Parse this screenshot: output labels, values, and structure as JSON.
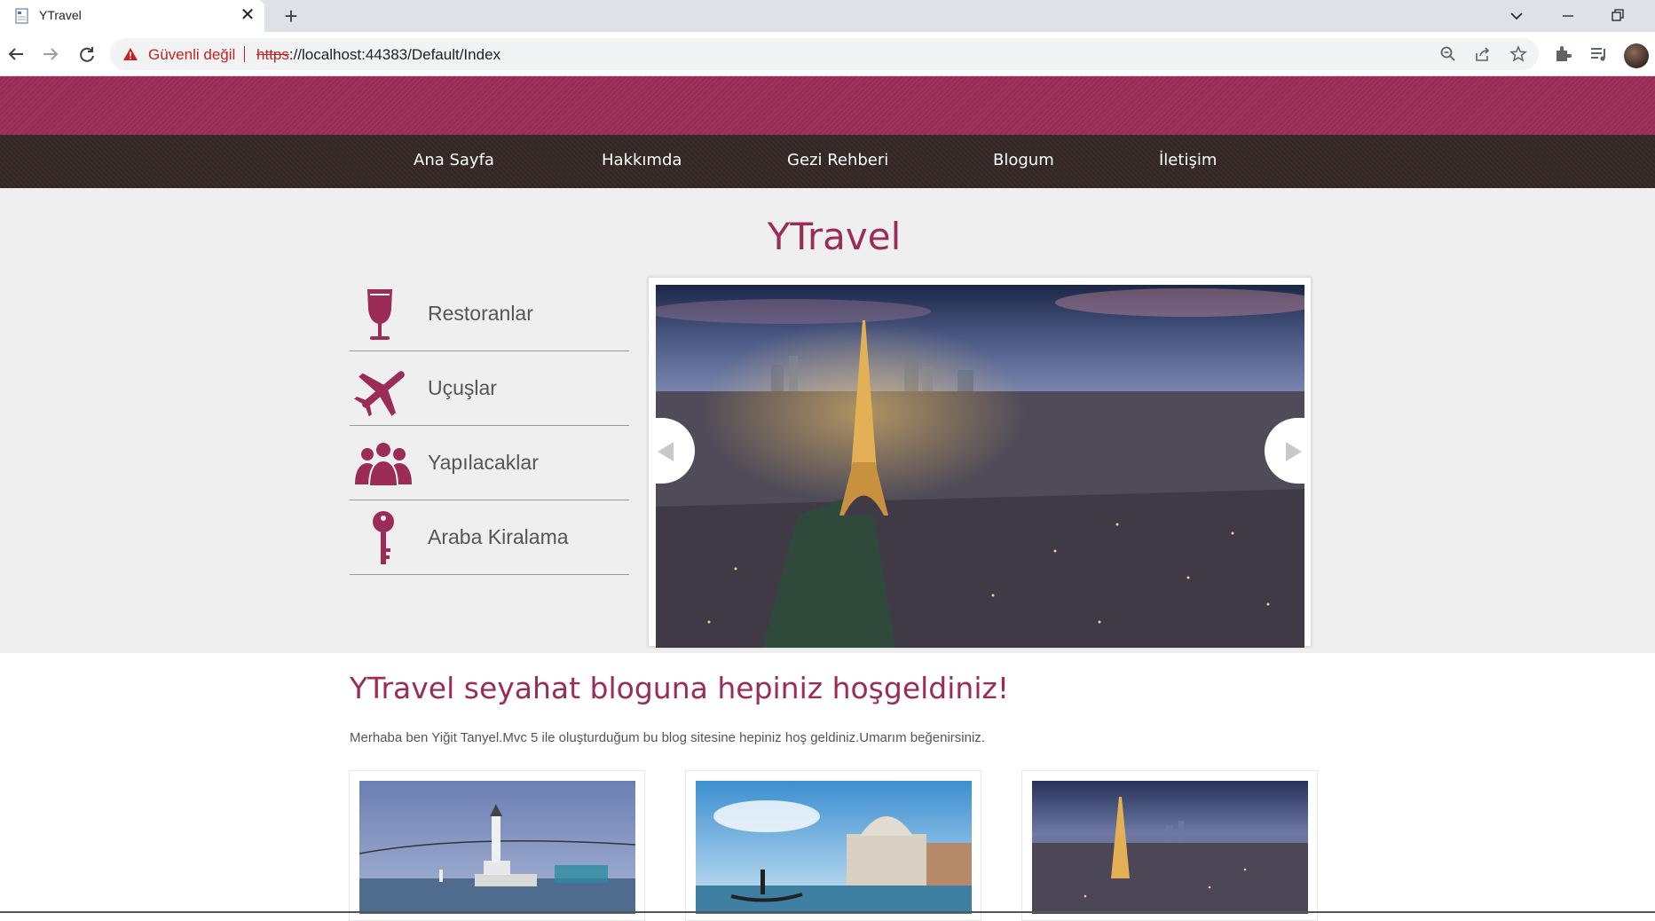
{
  "browser": {
    "tab_title": "YTravel",
    "security_label": "Güvenli değil",
    "url_scheme": "https",
    "url_rest": "://localhost:44383/Default/Index"
  },
  "nav": {
    "items": [
      {
        "label": "Ana Sayfa"
      },
      {
        "label": "Hakkımda"
      },
      {
        "label": "Gezi Rehberi"
      },
      {
        "label": "Blogum"
      },
      {
        "label": "İletişim"
      }
    ]
  },
  "hero": {
    "title": "YTravel",
    "menu": [
      {
        "label": "Restoranlar",
        "icon": "wine-glass-icon"
      },
      {
        "label": "Uçuşlar",
        "icon": "airplane-icon"
      },
      {
        "label": "Yapılacaklar",
        "icon": "people-icon"
      },
      {
        "label": "Araba Kiralama",
        "icon": "key-icon"
      }
    ]
  },
  "main": {
    "welcome_title": "YTravel seyahat bloguna hepiniz hoşgeldiniz!",
    "intro_text": "Merhaba ben Yiğit Tanyel.Mvc 5 ile oluşturduğum bu blog sitesine hepiniz hoş geldiniz.Umarım beğenirsiniz."
  },
  "colors": {
    "brand": "#9b2c55",
    "navbar": "#352826",
    "hero_bg": "#f0eff0"
  }
}
